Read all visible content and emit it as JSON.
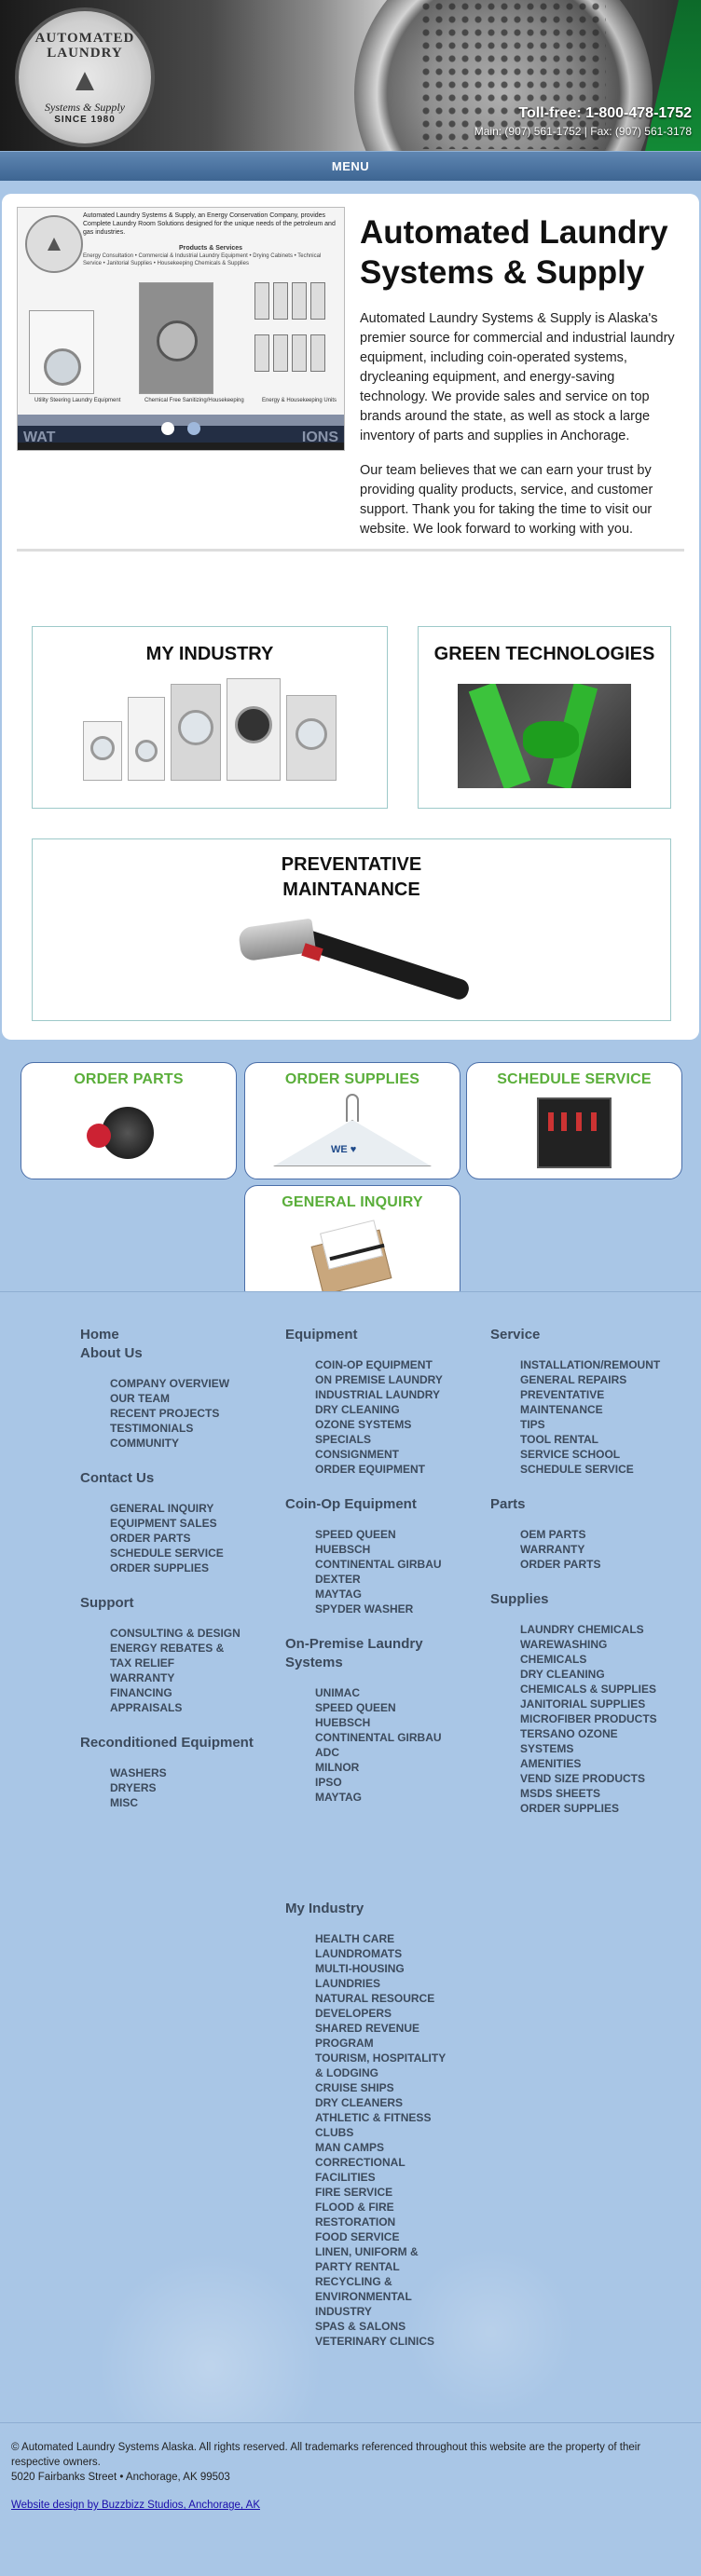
{
  "header": {
    "logo": {
      "ring_top": "AUTOMATED LAUNDRY",
      "script": "Systems & Supply",
      "since": "SINCE 1980"
    },
    "toll_free": "Toll-free: 1-800-478-1752",
    "main_fax": "Main: (907) 561-1752 | Fax: (907) 561-3178"
  },
  "menu": {
    "label": "MENU"
  },
  "intro": {
    "title": "Automated Laundry Systems & Supply",
    "paragraph1": "Automated Laundry Systems & Supply is Alaska's premier source for commercial and industrial laundry equipment, including coin-operated systems, drycleaning equipment, and energy-saving technology. We provide sales and service on top brands around the state, as well as stock a large inventory of parts and supplies in Anchorage.",
    "paragraph2": "Our team believes that we can earn your trust by providing quality products, service, and customer support. Thank you for taking the time to visit our website. We look forward to working with you."
  },
  "slider": {
    "headline": "Automated Laundry Systems & Supply, an Energy Conservation Company, provides Complete Laundry Room Solutions designed for the unique needs of the petroleum and gas industries.",
    "products_title": "Products & Services",
    "products_text": "Energy Consultation • Commercial & Industrial Laundry Equipment • Drying Cabinets • Technical Service • Janitorial Supplies • Housekeeping Chemicals & Supplies",
    "caption_left": "Utility Steering Laundry Equipment",
    "caption_mid": "Chemical Free Sanitizing/Housekeeping",
    "caption_right": "Energy & Housekeeping Units",
    "bar_left": "WAT",
    "bar_right": "IONS",
    "active_slide": 1,
    "slide_count": 2
  },
  "features": {
    "industry": "MY INDUSTRY",
    "green": "GREEN TECHNOLOGIES",
    "preventative": "PREVENTATIVE MAINTANANCE"
  },
  "actions": {
    "parts": "ORDER PARTS",
    "supplies": "ORDER SUPPLIES",
    "service": "SCHEDULE SERVICE",
    "inquiry": "GENERAL INQUIRY",
    "hanger_text": "WE ♥"
  },
  "footer_nav": {
    "col1": {
      "home": "Home",
      "about": {
        "title": "About Us",
        "items": [
          "COMPANY OVERVIEW",
          "OUR TEAM",
          "RECENT PROJECTS",
          "TESTIMONIALS",
          "COMMUNITY"
        ]
      },
      "contact": {
        "title": "Contact Us",
        "items": [
          "GENERAL INQUIRY",
          "EQUIPMENT SALES",
          "ORDER PARTS",
          "SCHEDULE SERVICE",
          "ORDER SUPPLIES"
        ]
      },
      "support": {
        "title": "Support",
        "items": [
          "CONSULTING & DESIGN",
          "ENERGY REBATES &",
          "TAX RELIEF",
          "WARRANTY",
          "FINANCING",
          "APPRAISALS"
        ]
      },
      "recon": {
        "title": "Reconditioned Equipment",
        "items": [
          "WASHERS",
          "DRYERS",
          "MISC"
        ]
      }
    },
    "col2": {
      "equipment": {
        "title": "Equipment",
        "items": [
          "COIN-OP EQUIPMENT",
          "ON PREMISE LAUNDRY",
          "INDUSTRIAL LAUNDRY",
          "DRY CLEANING",
          "OZONE SYSTEMS",
          "SPECIALS",
          "CONSIGNMENT",
          "ORDER EQUIPMENT"
        ]
      },
      "coinop": {
        "title": "Coin-Op Equipment",
        "items": [
          "SPEED QUEEN",
          "HUEBSCH",
          "CONTINENTAL GIRBAU",
          "DEXTER",
          "MAYTAG",
          "SPYDER WASHER"
        ]
      },
      "onprem": {
        "title": "On-Premise Laundry Systems",
        "items": [
          "UNIMAC",
          "SPEED QUEEN",
          "HUEBSCH",
          "CONTINENTAL GIRBAU",
          "ADC",
          "MILNOR",
          "IPSO",
          "MAYTAG"
        ]
      },
      "myindustry": {
        "title": "My Industry",
        "items": [
          "HEALTH CARE",
          "LAUNDROMATS",
          "MULTI-HOUSING",
          "LAUNDRIES",
          "NATURAL RESOURCE",
          "DEVELOPERS",
          "SHARED REVENUE",
          "PROGRAM",
          "TOURISM, HOSPITALITY",
          "& LODGING",
          "CRUISE SHIPS",
          "DRY CLEANERS",
          "ATHLETIC & FITNESS",
          "CLUBS",
          "MAN CAMPS",
          "CORRECTIONAL",
          "FACILITIES",
          "FIRE SERVICE",
          "FLOOD & FIRE",
          "RESTORATION",
          "FOOD SERVICE",
          "LINEN, UNIFORM &",
          "PARTY RENTAL",
          "RECYCLING &",
          "ENVIRONMENTAL",
          "INDUSTRY",
          "SPAS & SALONS",
          "VETERINARY CLINICS"
        ]
      }
    },
    "col3": {
      "service": {
        "title": "Service",
        "items": [
          "INSTALLATION/REMOUNT",
          "GENERAL REPAIRS",
          "PREVENTATIVE",
          "MAINTENANCE",
          "TIPS",
          "TOOL RENTAL",
          "SERVICE SCHOOL",
          "SCHEDULE SERVICE"
        ]
      },
      "parts": {
        "title": "Parts",
        "items": [
          "OEM PARTS",
          "WARRANTY",
          "ORDER PARTS"
        ]
      },
      "supplies": {
        "title": "Supplies",
        "items": [
          "LAUNDRY CHEMICALS",
          "WAREWASHING",
          "CHEMICALS",
          "DRY CLEANING",
          "CHEMICALS & SUPPLIES",
          "JANITORIAL SUPPLIES",
          "MICROFIBER PRODUCTS",
          "TERSANO OZONE",
          "SYSTEMS",
          "AMENITIES",
          "VEND SIZE PRODUCTS",
          "MSDS SHEETS",
          "ORDER SUPPLIES"
        ]
      }
    }
  },
  "bottom": {
    "copyright": "© Automated Laundry Systems Alaska. All rights reserved. All trademarks referenced throughout this website are the property of their respective owners.",
    "address": "5020 Fairbanks Street • Anchorage, AK 99503",
    "credit": "Website design by Buzzbizz Studios, Anchorage, AK"
  }
}
